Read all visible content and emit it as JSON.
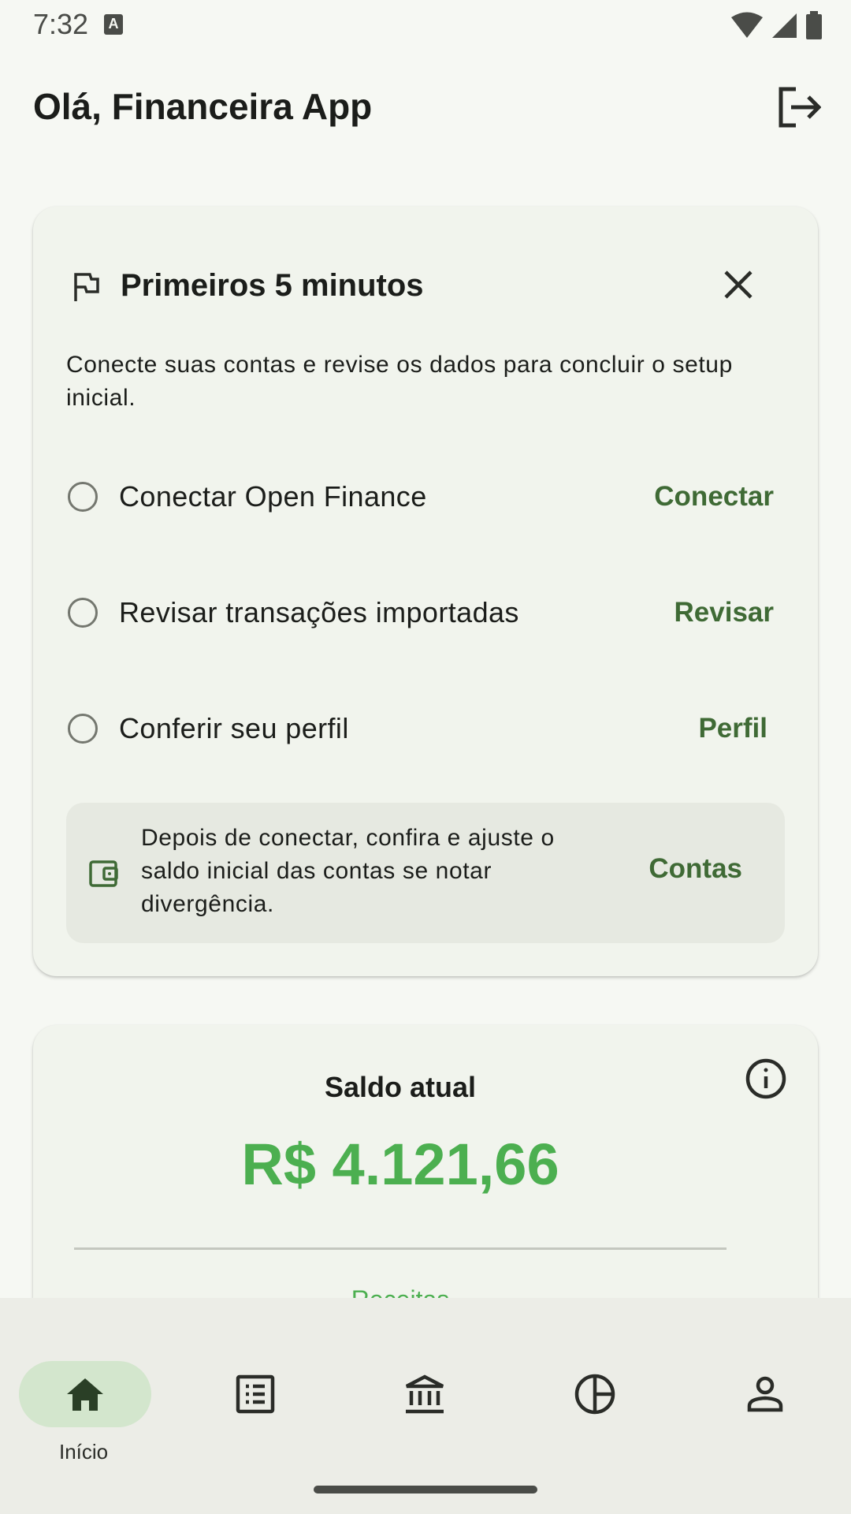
{
  "status_bar": {
    "time": "7:32",
    "notification_icon": "a-icon"
  },
  "header": {
    "greeting": "Olá, Financeira App",
    "logout_icon": "logout-icon"
  },
  "onboarding": {
    "title": "Primeiros 5 minutos",
    "description": "Conecte suas contas e revise os dados para concluir o setup inicial.",
    "tasks": [
      {
        "label": "Conectar Open Finance",
        "action": "Conectar"
      },
      {
        "label": "Revisar transações importadas",
        "action": "Revisar"
      },
      {
        "label": "Conferir seu perfil",
        "action": "Perfil"
      }
    ],
    "info": {
      "text": "Depois de conectar, confira e ajuste o saldo inicial das contas se notar divergência.",
      "action": "Contas"
    }
  },
  "balance": {
    "label": "Saldo atual",
    "value": "R$ 4.121,66",
    "income_label": "Receitas"
  },
  "nav": {
    "items": [
      {
        "label": "Início",
        "icon": "home-icon",
        "active": true
      },
      {
        "label": "",
        "icon": "list-icon"
      },
      {
        "label": "",
        "icon": "bank-icon"
      },
      {
        "label": "",
        "icon": "pie-chart-icon"
      },
      {
        "label": "",
        "icon": "person-icon"
      }
    ]
  },
  "colors": {
    "accent": "#3f6a35",
    "balance": "#4caf50",
    "nav_active": "#d3e6cd"
  }
}
